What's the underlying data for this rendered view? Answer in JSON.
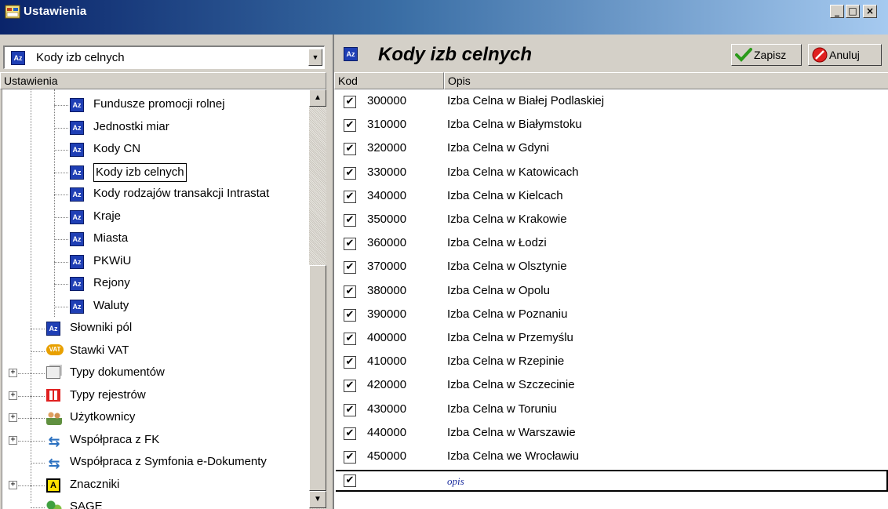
{
  "window": {
    "title": "Ustawienia",
    "buttons": {
      "minimize": "_",
      "maximize": "□",
      "close": "×"
    },
    "accent": "#0a246a"
  },
  "left": {
    "combo_value": "Kody izb celnych",
    "header": "Ustawienia",
    "tree": [
      {
        "label": "Fundusze promocji rolnej",
        "icon": "az-icon"
      },
      {
        "label": "Jednostki miar",
        "icon": "az-icon"
      },
      {
        "label": "Kody CN",
        "icon": "az-icon"
      },
      {
        "label": "Kody izb celnych",
        "icon": "az-icon",
        "selected": true
      },
      {
        "label": "Kody rodzajów transakcji Intrastat",
        "icon": "az-icon"
      },
      {
        "label": "Kraje",
        "icon": "az-icon"
      },
      {
        "label": "Miasta",
        "icon": "az-icon"
      },
      {
        "label": "PKWiU",
        "icon": "az-icon"
      },
      {
        "label": "Rejony",
        "icon": "az-icon"
      },
      {
        "label": "Waluty",
        "icon": "az-icon"
      },
      {
        "label": "Słowniki pól",
        "icon": "az-icon"
      },
      {
        "label": "Stawki VAT",
        "icon": "vat-icon"
      },
      {
        "label": "Typy dokumentów",
        "icon": "documents-icon"
      },
      {
        "label": "Typy rejestrów",
        "icon": "register-icon"
      },
      {
        "label": "Użytkownicy",
        "icon": "users-icon"
      },
      {
        "label": "Współpraca z FK",
        "icon": "sync-icon"
      },
      {
        "label": "Współpraca z Symfonia e-Dokumenty",
        "icon": "sync-icon"
      },
      {
        "label": "Znaczniki",
        "icon": "marker-icon"
      },
      {
        "label": "SAGE",
        "icon": "sage-icon"
      }
    ]
  },
  "right": {
    "title": "Kody izb celnych",
    "save_label": "Zapisz",
    "cancel_label": "Anuluj",
    "columns": {
      "kod": "Kod",
      "opis": "Opis"
    },
    "rows": [
      {
        "kod": "300000",
        "opis": "Izba Celna w Białej Podlaskiej"
      },
      {
        "kod": "310000",
        "opis": "Izba Celna w Białymstoku"
      },
      {
        "kod": "320000",
        "opis": "Izba Celna w Gdyni"
      },
      {
        "kod": "330000",
        "opis": "Izba Celna w Katowicach"
      },
      {
        "kod": "340000",
        "opis": "Izba Celna w Kielcach"
      },
      {
        "kod": "350000",
        "opis": "Izba Celna w Krakowie"
      },
      {
        "kod": "360000",
        "opis": "Izba Celna w Łodzi"
      },
      {
        "kod": "370000",
        "opis": "Izba Celna w Olsztynie"
      },
      {
        "kod": "380000",
        "opis": "Izba Celna w Opolu"
      },
      {
        "kod": "390000",
        "opis": "Izba Celna w Poznaniu"
      },
      {
        "kod": "400000",
        "opis": "Izba Celna w Przemyślu"
      },
      {
        "kod": "410000",
        "opis": "Izba Celna w Rzepinie"
      },
      {
        "kod": "420000",
        "opis": "Izba Celna w Szczecinie"
      },
      {
        "kod": "430000",
        "opis": "Izba Celna w Toruniu"
      },
      {
        "kod": "440000",
        "opis": "Izba Celna w Warszawie"
      },
      {
        "kod": "450000",
        "opis": "Izba Celna we Wrocławiu"
      }
    ],
    "new_row_placeholder": "opis"
  }
}
